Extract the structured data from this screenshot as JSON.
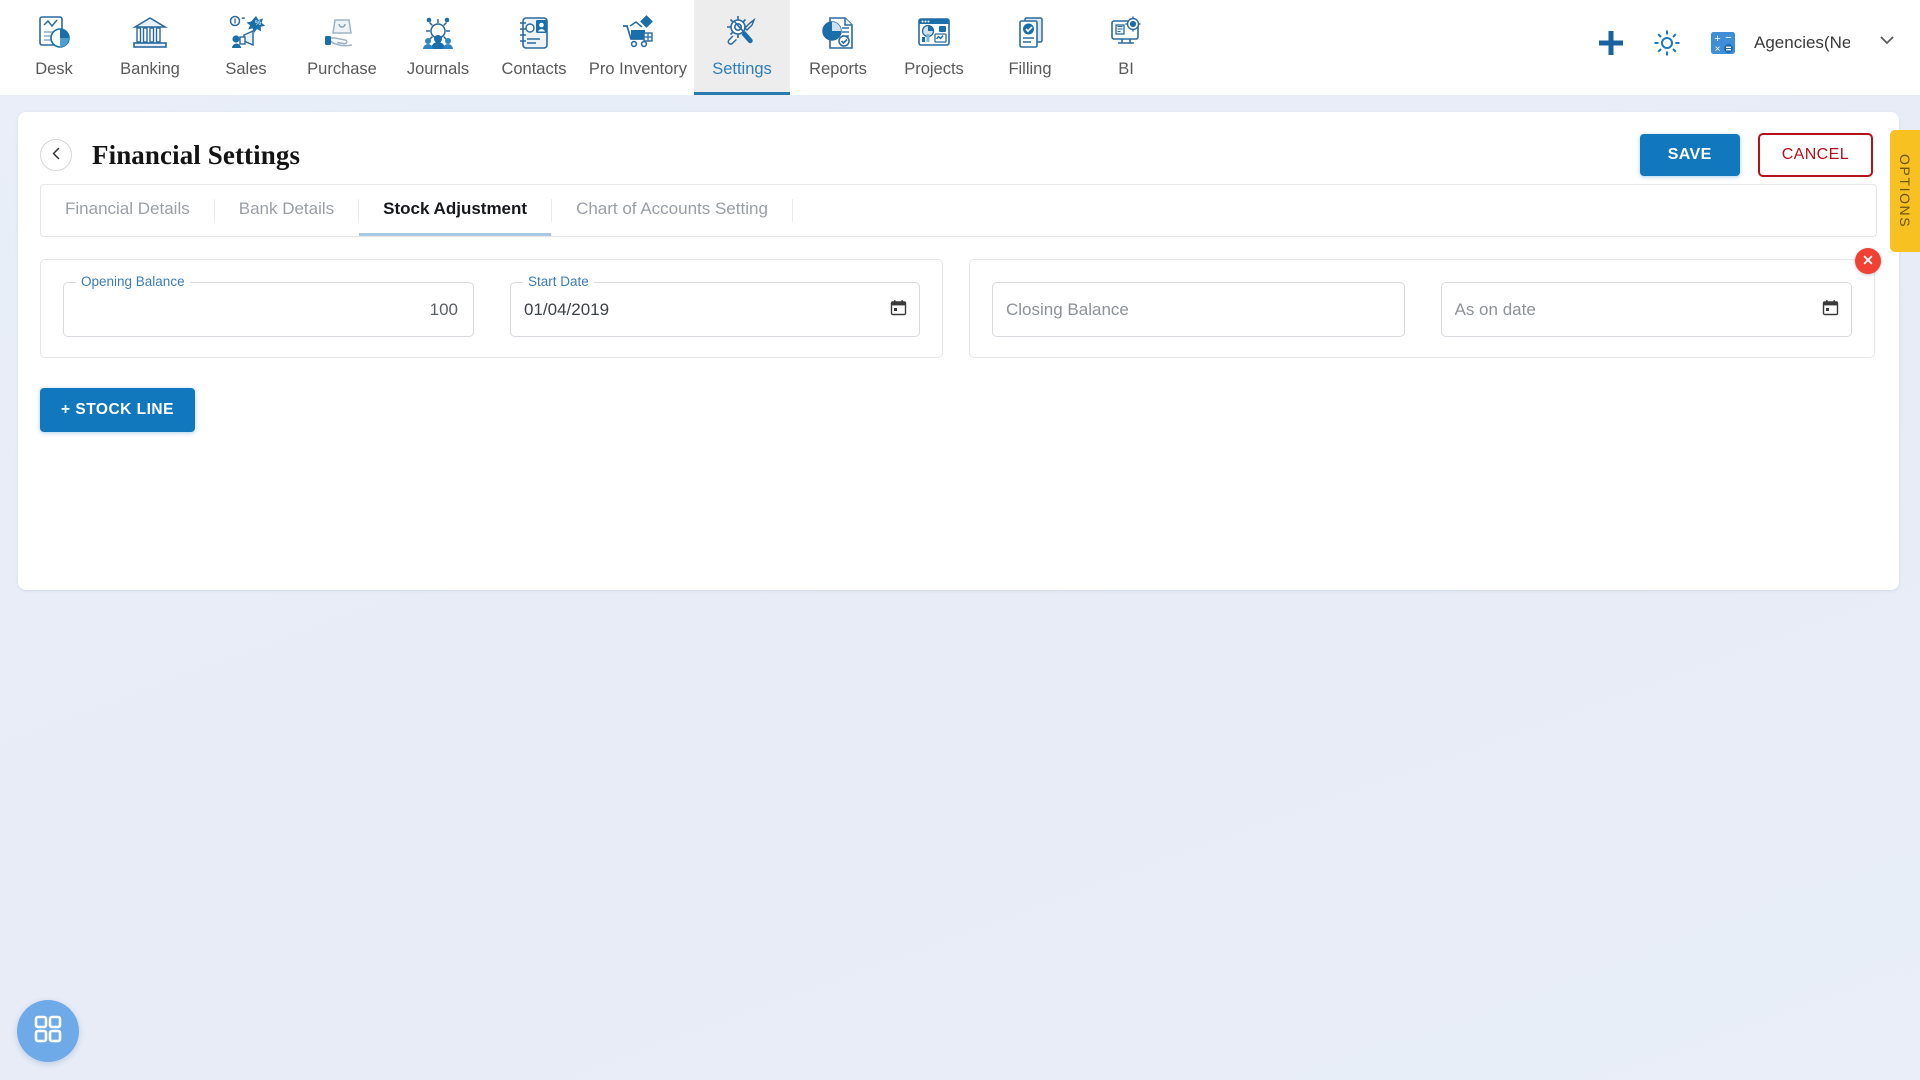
{
  "topnav": {
    "items": [
      {
        "label": "Desk",
        "icon": "desk-dashboard-icon",
        "active": false
      },
      {
        "label": "Banking",
        "icon": "bank-building-icon",
        "active": false
      },
      {
        "label": "Sales",
        "icon": "sales-megaphone-icon",
        "active": false
      },
      {
        "label": "Purchase",
        "icon": "purchase-bag-hand-icon",
        "active": false
      },
      {
        "label": "Journals",
        "icon": "journals-people-gear-icon",
        "active": false
      },
      {
        "label": "Contacts",
        "icon": "contacts-book-icon",
        "active": false
      },
      {
        "label": "Pro Inventory",
        "icon": "inventory-cart-icon",
        "active": false
      },
      {
        "label": "Settings",
        "icon": "settings-gear-wrench-icon",
        "active": true
      },
      {
        "label": "Reports",
        "icon": "reports-piechart-doc-icon",
        "active": false
      },
      {
        "label": "Projects",
        "icon": "projects-window-chart-icon",
        "active": false
      },
      {
        "label": "Filling",
        "icon": "filling-check-docs-icon",
        "active": false
      },
      {
        "label": "BI",
        "icon": "bi-monitor-gear-icon",
        "active": false
      }
    ],
    "right": {
      "add_icon": "plus-icon",
      "settings_icon": "gear-icon",
      "calculator_icon": "calculator-icon",
      "account_name": "Agencies(Nec",
      "chevron_icon": "chevron-down-icon"
    }
  },
  "page": {
    "back_icon": "chevron-left-icon",
    "title": "Financial Settings",
    "save_label": "SAVE",
    "cancel_label": "CANCEL",
    "options_label": "OPTIONS"
  },
  "tabs": [
    {
      "label": "Financial Details",
      "active": false
    },
    {
      "label": "Bank Details",
      "active": false
    },
    {
      "label": "Stock Adjustment",
      "active": true
    },
    {
      "label": "Chart of Accounts Setting",
      "active": false
    }
  ],
  "form": {
    "opening_balance": {
      "label": "Opening Balance",
      "value": "100",
      "placeholder": ""
    },
    "start_date": {
      "label": "Start Date",
      "value": "01/04/2019",
      "placeholder": "",
      "icon": "calendar-icon"
    },
    "closing_balance": {
      "label": "",
      "value": "",
      "placeholder": "Closing Balance"
    },
    "as_on_date": {
      "label": "",
      "value": "",
      "placeholder": "As on date",
      "icon": "calendar-icon"
    },
    "delete_icon": "close-x-icon",
    "add_stock_line_label": "+ STOCK LINE"
  },
  "fab": {
    "icon": "apps-grid-icon"
  },
  "colors": {
    "primary_blue": "#1278bd",
    "accent_blue": "#2f7fb5",
    "danger_red": "#b3121b",
    "delete_red": "#f04134",
    "options_yellow": "#f7c122",
    "page_bg": "#e9edf7",
    "label_blue": "#3b7db5"
  }
}
